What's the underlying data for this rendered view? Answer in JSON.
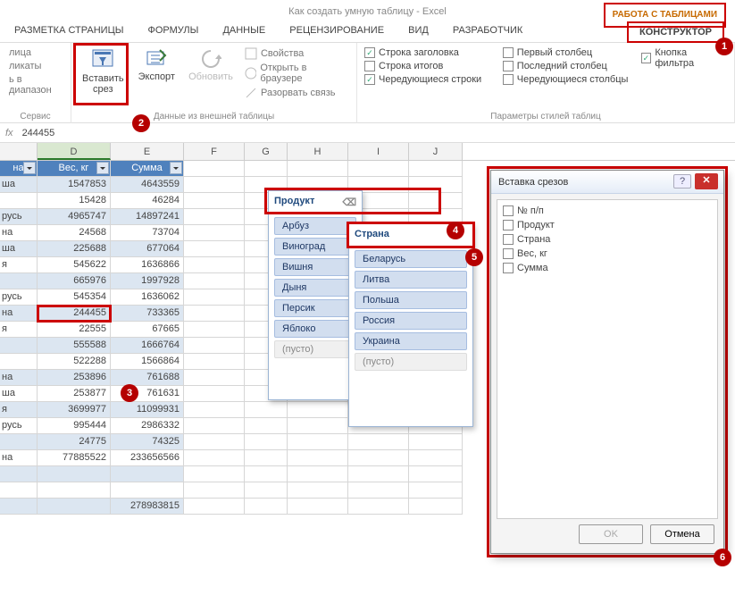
{
  "title": "Как создать умную таблицу - Excel",
  "tabletools": "РАБОТА С ТАБЛИЦАМИ",
  "tabs": {
    "layout": "РАЗМЕТКА СТРАНИЦЫ",
    "formulas": "ФОРМУЛЫ",
    "data": "ДАННЫЕ",
    "review": "РЕЦЕНЗИРОВАНИЕ",
    "view": "ВИД",
    "dev": "РАЗРАБОТЧИК",
    "design": "КОНСТРУКТОР"
  },
  "ribbon": {
    "g1": {
      "items": [
        "лица",
        "ликаты",
        "ь в диапазон"
      ],
      "label": "Сервис"
    },
    "g2": {
      "slicer": "Вставить\nсрез",
      "export": "Экспорт",
      "refresh": "Обновить",
      "props": "Свойства",
      "open": "Открыть в браузере",
      "unlink": "Разорвать связь",
      "label": "Данные из внешней таблицы"
    },
    "g3": {
      "header": "Строка заголовка",
      "totals": "Строка итогов",
      "banded_r": "Чередующиеся строки",
      "first": "Первый столбец",
      "last": "Последний столбец",
      "banded_c": "Чередующиеся столбцы",
      "filter": "Кнопка фильтра",
      "label": "Параметры стилей таблиц"
    }
  },
  "fx": "244455",
  "cols": [
    "",
    "D",
    "E",
    "F",
    "G",
    "H",
    "I",
    "J"
  ],
  "headers": {
    "a": "на",
    "d": "Вес, кг",
    "e": "Сумма"
  },
  "rows": [
    {
      "a": "ша",
      "d": "1547853",
      "e": "4643559"
    },
    {
      "a": "",
      "d": "15428",
      "e": "46284"
    },
    {
      "a": "русь",
      "d": "4965747",
      "e": "14897241"
    },
    {
      "a": "на",
      "d": "24568",
      "e": "73704"
    },
    {
      "a": "ша",
      "d": "225688",
      "e": "677064"
    },
    {
      "a": "я",
      "d": "545622",
      "e": "1636866"
    },
    {
      "a": "",
      "d": "665976",
      "e": "1997928"
    },
    {
      "a": "русь",
      "d": "545354",
      "e": "1636062"
    },
    {
      "a": "на",
      "d": "244455",
      "e": "733365"
    },
    {
      "a": "я",
      "d": "22555",
      "e": "67665"
    },
    {
      "a": "",
      "d": "555588",
      "e": "1666764"
    },
    {
      "a": "",
      "d": "522288",
      "e": "1566864"
    },
    {
      "a": "на",
      "d": "253896",
      "e": "761688"
    },
    {
      "a": "ша",
      "d": "253877",
      "e": "761631"
    },
    {
      "a": "я",
      "d": "3699977",
      "e": "11099931"
    },
    {
      "a": "русь",
      "d": "995444",
      "e": "2986332"
    },
    {
      "a": "",
      "d": "24775",
      "e": "74325"
    },
    {
      "a": "на",
      "d": "77885522",
      "e": "233656566"
    },
    {
      "a": "",
      "d": "",
      "e": ""
    },
    {
      "a": "",
      "d": "",
      "e": ""
    },
    {
      "a": "",
      "d": "",
      "e": "278983815"
    }
  ],
  "slicer1": {
    "title": "Продукт",
    "items": [
      "Арбуз",
      "Виноград",
      "Вишня",
      "Дыня",
      "Персик",
      "Яблоко"
    ],
    "empty": "(пусто)"
  },
  "slicer2": {
    "title": "Страна",
    "items": [
      "Беларусь",
      "Литва",
      "Польша",
      "Россия",
      "Украина"
    ],
    "empty": "(пусто)"
  },
  "dialog": {
    "title": "Вставка срезов",
    "fields": [
      "№ п/п",
      "Продукт",
      "Страна",
      "Вес, кг",
      "Сумма"
    ],
    "ok": "OK",
    "cancel": "Отмена"
  },
  "chart_data": {
    "type": "table",
    "headers": [
      "Страна",
      "Вес, кг",
      "Сумма"
    ],
    "note": "partial view; leftmost column truncated at left edge",
    "rows": [
      [
        "…ша",
        1547853,
        4643559
      ],
      [
        "",
        15428,
        46284
      ],
      [
        "…русь",
        4965747,
        14897241
      ],
      [
        "…на",
        24568,
        73704
      ],
      [
        "…ша",
        225688,
        677064
      ],
      [
        "…я",
        545622,
        1636866
      ],
      [
        "",
        665976,
        1997928
      ],
      [
        "…русь",
        545354,
        1636062
      ],
      [
        "…на",
        244455,
        733365
      ],
      [
        "…я",
        22555,
        67665
      ],
      [
        "",
        555588,
        1666764
      ],
      [
        "",
        522288,
        1566864
      ],
      [
        "…на",
        253896,
        761688
      ],
      [
        "…ша",
        253877,
        761631
      ],
      [
        "…я",
        3699977,
        11099931
      ],
      [
        "…русь",
        995444,
        2986332
      ],
      [
        "",
        24775,
        74325
      ],
      [
        "…на",
        77885522,
        233656566
      ]
    ],
    "total_sum": 278983815
  }
}
